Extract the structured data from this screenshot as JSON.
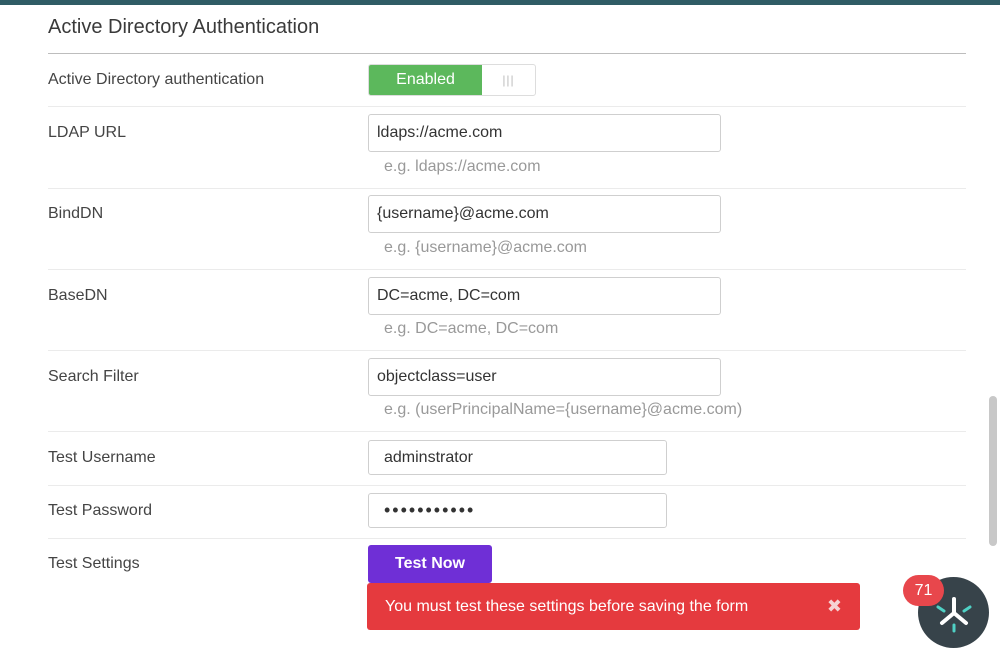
{
  "section": {
    "title": "Active Directory Authentication"
  },
  "fields": {
    "ad_auth": {
      "label": "Active Directory authentication",
      "toggle_label": "Enabled",
      "toggle_handle": "|||"
    },
    "ldap_url": {
      "label": "LDAP URL",
      "value": "ldaps://acme.com",
      "hint": "e.g. ldaps://acme.com"
    },
    "bind_dn": {
      "label": "BindDN",
      "value": "{username}@acme.com",
      "hint": "e.g. {username}@acme.com"
    },
    "base_dn": {
      "label": "BaseDN",
      "value": "DC=acme, DC=com",
      "hint": "e.g. DC=acme, DC=com"
    },
    "search_filter": {
      "label": "Search Filter",
      "value": "objectclass=user",
      "hint": "e.g. (userPrincipalName={username}@acme.com)"
    },
    "test_username": {
      "label": "Test Username",
      "value": "adminstrator"
    },
    "test_password": {
      "label": "Test Password",
      "value": "•••••••••••"
    },
    "test_settings": {
      "label": "Test Settings",
      "button_label": "Test Now"
    }
  },
  "alert": {
    "message": "You must test these settings before saving the form",
    "close_glyph": "✖"
  },
  "widget": {
    "badge_count": "71"
  },
  "colors": {
    "toggle_on": "#5cb85c",
    "primary_button": "#6f2fd6",
    "alert": "#e53a3e",
    "badge": "#e8474c",
    "top_bar": "#2f5c65"
  }
}
